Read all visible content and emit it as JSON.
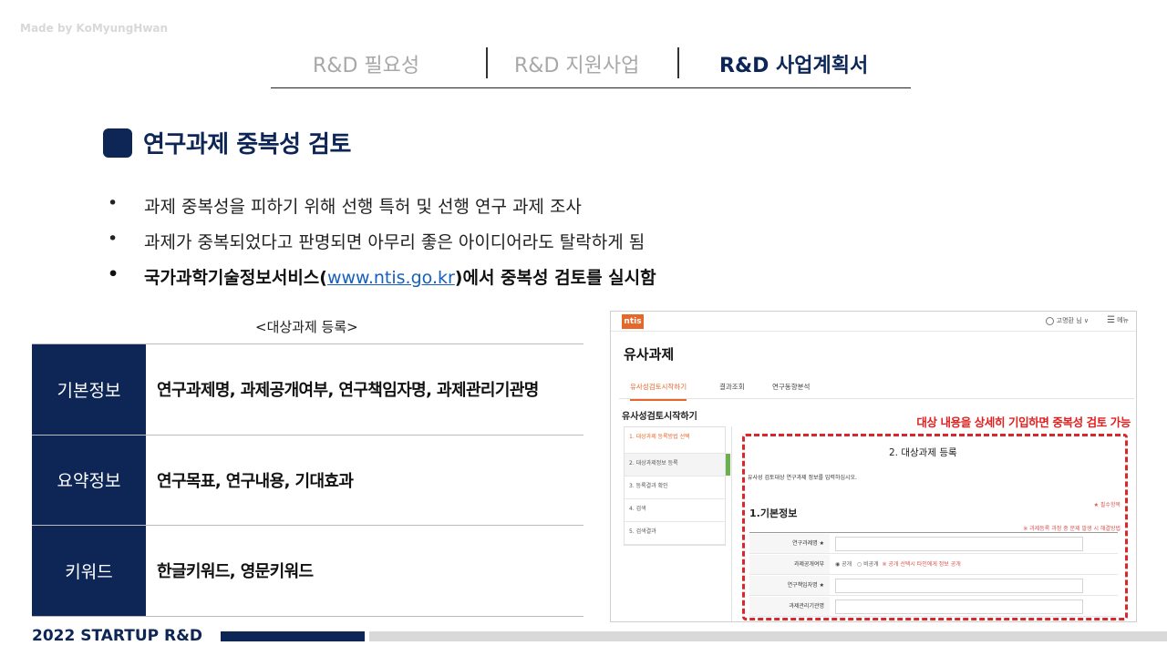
{
  "watermark": "Made by KoMyungHwan",
  "nav": {
    "tab1": "R&D 필요성",
    "tab2": "R&D 지원사업",
    "tab3": "R&D 사업계획서"
  },
  "section": {
    "title": "연구과제 중복성 검토"
  },
  "bullets": {
    "dot": "•",
    "b1": "과제 중복성을 피하기 위해 선행 특허 및 선행 연구 과제 조사",
    "b2": "과제가 중복되었다고 판명되면 아무리 좋은 아이디어라도 탈락하게 됨",
    "b3_pre": "국가과학기술정보서비스(",
    "b3_link": "www.ntis.go.kr",
    "b3_post": ")에서 중복성 검토를 실시함"
  },
  "table": {
    "caption": "<대상과제 등록>",
    "rows": [
      {
        "label": "기본정보",
        "value": "연구과제명, 과제공개여부, 연구책임자명, 과제관리기관명"
      },
      {
        "label": "요약정보",
        "value": "연구목표, 연구내용, 기대효과"
      },
      {
        "label": "키워드",
        "value": "한글키워드, 영문키워드"
      }
    ]
  },
  "screenshot": {
    "logo": "ntis",
    "user": "고명환 님 ∨",
    "menu": "메뉴",
    "page_title": "유사과제",
    "tabs": [
      "유사성검토시작하기",
      "결과조회",
      "연구동향분석"
    ],
    "left_title": "유사성검토시작하기",
    "red_note": "대상 내용을 상세히 기입하면 중복성 검토 가능",
    "steps": [
      "1. 대상과제 등록방법 선택",
      "2. 대상과제정보 등록",
      "3. 등록결과 확인",
      "4. 검색",
      "5. 검색결과"
    ],
    "form_title": "2. 대상과제 등록",
    "form_desc": "유사성 검토대상 연구과제 정보를 입력하십시오.",
    "form_section": "1.기본정보",
    "required": "★ 필수항목",
    "help": "※ 과제등록 과정 중 문제 발생 시 해결방법",
    "fields": [
      "연구과제명 ★",
      "과제공개여부",
      "연구책임자명 ★",
      "과제관리기관명"
    ],
    "radio_public": "◉ 공개",
    "radio_private": "○ 비공개",
    "radio_note": "※ 공개 선택시 타인에게 정보 공개"
  },
  "footer": {
    "text": "2022 STARTUP R&D"
  },
  "colors": {
    "navy": "#0d2656",
    "red": "#e01f1f",
    "orange": "#e3682a"
  }
}
